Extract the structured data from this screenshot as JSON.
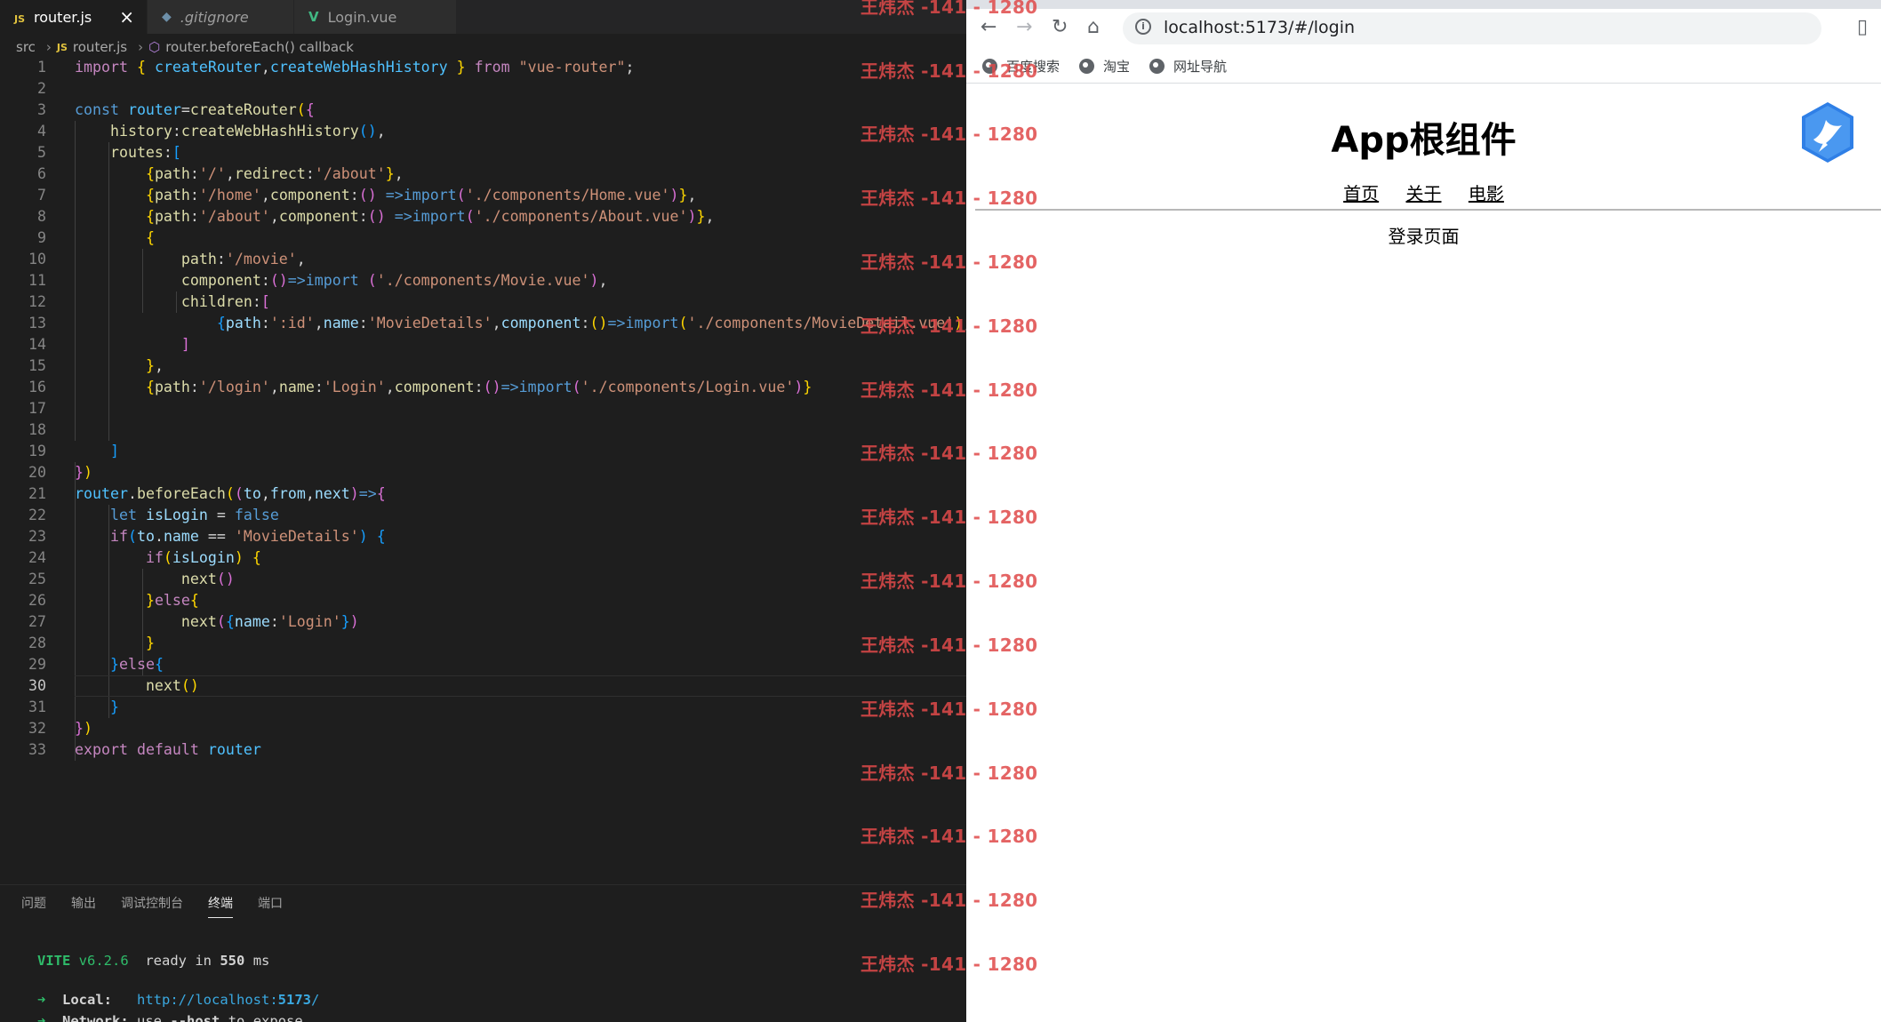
{
  "editor": {
    "tabs": [
      {
        "icon": "JS",
        "label": "router.js",
        "active": true
      },
      {
        "icon": "◆",
        "label": ".gitignore",
        "active": false
      },
      {
        "icon": "V",
        "label": "Login.vue",
        "active": false
      }
    ],
    "breadcrumb": {
      "folder": "src",
      "file_icon": "JS",
      "file": "router.js",
      "symbol": "router.beforeEach() callback"
    },
    "lines": [
      "1",
      "2",
      "3",
      "4",
      "5",
      "6",
      "7",
      "8",
      "9",
      "10",
      "11",
      "12",
      "13",
      "14",
      "15",
      "16",
      "17",
      "18",
      "19",
      "20",
      "21",
      "22",
      "23",
      "24",
      "25",
      "26",
      "27",
      "28",
      "29",
      "30",
      "31",
      "32",
      "33"
    ],
    "current_line": "30"
  },
  "watermark": "王炜杰 -141 - 1280",
  "panel": {
    "tabs": [
      "问题",
      "输出",
      "调试控制台",
      "终端",
      "端口"
    ],
    "active_tab": "终端",
    "vite_label": "VITE",
    "vite_version": "v6.2.6",
    "ready_text": "ready in",
    "ready_ms": "550",
    "ms_unit": "ms",
    "local_label": "Local:",
    "local_url_prefix": "http://localhost:",
    "local_port": "5173",
    "network_label": "Network:",
    "network_text_a": "use",
    "network_flag": "--host",
    "network_text_b": "to expose"
  },
  "browser": {
    "url": "localhost:5173/#/login",
    "bookmarks": [
      "百度搜索",
      "淘宝",
      "网址导航"
    ],
    "app_title": "App根组件",
    "nav": [
      "首页",
      "关于",
      "电影"
    ],
    "view_text": "登录页面"
  }
}
